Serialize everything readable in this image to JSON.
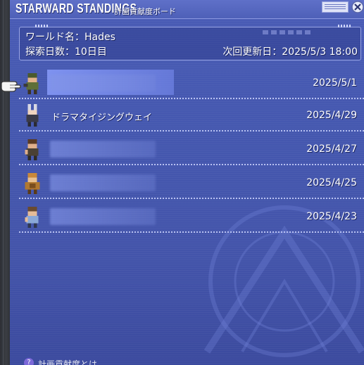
{
  "window": {
    "title": "STARWARD STANDINGS",
    "subtitle": "計画貢献度ボード"
  },
  "info": {
    "world_label": "ワールド名：Hades",
    "days_label": "探索日数：10日目",
    "next_update_label": "次回更新日：2025/5/3 18:00"
  },
  "rows": [
    {
      "name": "",
      "date": "2025/5/1",
      "selected": true,
      "avatar": "soldier-sprite"
    },
    {
      "name": "ドラマタイジングウェイ",
      "date": "2025/4/29",
      "selected": false,
      "avatar": "rabbit-sprite"
    },
    {
      "name": "",
      "date": "2025/4/27",
      "selected": false,
      "avatar": "pilot-sprite"
    },
    {
      "name": "",
      "date": "2025/4/25",
      "selected": false,
      "avatar": "armored-sprite"
    },
    {
      "name": "",
      "date": "2025/4/23",
      "selected": false,
      "avatar": "scout-sprite"
    }
  ],
  "footer": {
    "badge": "?",
    "text": "計画貢献度とは"
  },
  "icons": {
    "pointer": "pointer-hand-icon",
    "close": "close-icon",
    "window": "window-toggle-icon"
  },
  "colors": {
    "panel": "#4558b0",
    "titlebar": "#5f70c8",
    "text": "#ffffff",
    "separator": "#b9c2f2"
  }
}
